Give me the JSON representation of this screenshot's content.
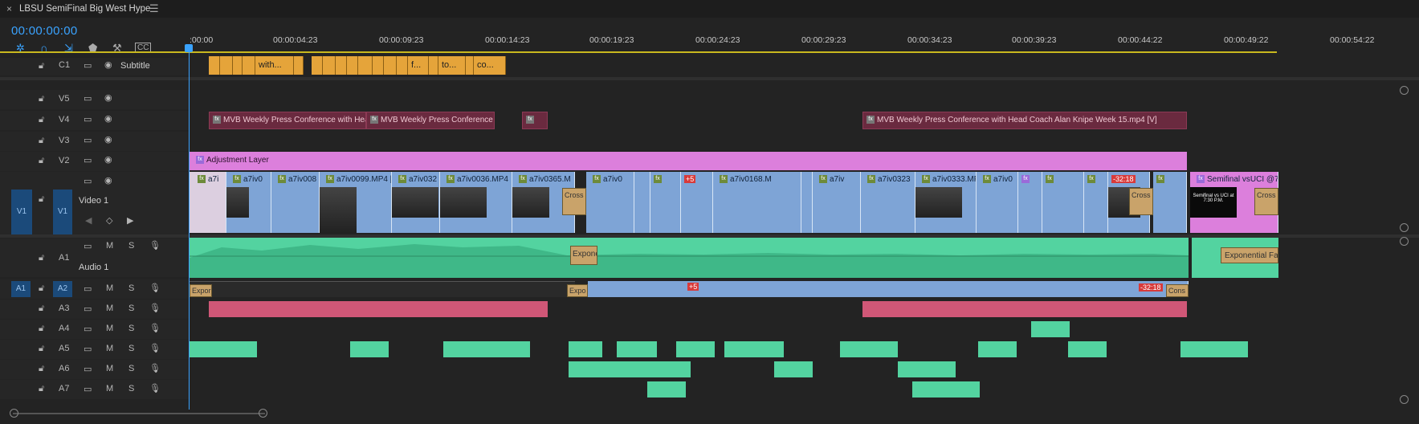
{
  "window": {
    "close_glyph": "×",
    "sequence_name": "LBSU SemiFinal Big West Hype",
    "menu_glyph": "☰"
  },
  "timecode": "00:00:00:00",
  "toolbar": [
    {
      "icon": "snap-icon"
    },
    {
      "icon": "linked-selection-icon"
    },
    {
      "icon": "insert-icon"
    },
    {
      "icon": "marker-icon"
    },
    {
      "icon": "wrench-icon"
    },
    {
      "icon": "captions-icon"
    }
  ],
  "ruler": {
    "labels": [
      ":00:00",
      "00:00:04:23",
      "00:00:09:23",
      "00:00:14:23",
      "00:00:19:23",
      "00:00:24:23",
      "00:00:29:23",
      "00:00:34:23",
      "00:00:39:23",
      "00:00:44:22",
      "00:00:49:22",
      "00:00:54:22"
    ]
  },
  "tracks": {
    "c1": {
      "id": "C1",
      "name": "Subtitle"
    },
    "video": [
      {
        "id": "V5"
      },
      {
        "id": "V4"
      },
      {
        "id": "V3"
      },
      {
        "id": "V2"
      },
      {
        "id": "V1",
        "source": "V1",
        "name": "Video 1"
      }
    ],
    "audio": [
      {
        "id": "A1",
        "name": "Audio 1",
        "m": "M",
        "s": "S"
      },
      {
        "id": "A2",
        "source": "A1",
        "m": "M",
        "s": "S"
      },
      {
        "id": "A3",
        "m": "M",
        "s": "S"
      },
      {
        "id": "A4",
        "m": "M",
        "s": "S"
      },
      {
        "id": "A5",
        "m": "M",
        "s": "S"
      },
      {
        "id": "A6",
        "m": "M",
        "s": "S"
      },
      {
        "id": "A7",
        "m": "M",
        "s": "S"
      }
    ]
  },
  "clips": {
    "subtitles": [
      "with...",
      "f...",
      "to...",
      "co..."
    ],
    "v4": [
      "MVB Weekly Press Conference with Hea",
      "MVB Weekly Press Conference",
      "",
      "MVB Weekly Press Conference with Head Coach Alan Knipe   Week 15.mp4 [V]"
    ],
    "v2": "Adjustment Layer",
    "v1": [
      "a7i",
      "a7iv0",
      "a7iv008",
      "a7iv0099.MP4 [",
      "a7iv032",
      "a7iv0036.MP4",
      "a7iv0365.M",
      "a7iv0",
      "a7iv0168.M",
      "a7iv",
      "a7iv0323",
      "a7iv0333.MP",
      "a7iv0",
      "Semifinal vsUCI @7:"
    ],
    "v1_badges": [
      "+5",
      "-32:18"
    ],
    "v1_transitions": [
      "Cross D",
      "Cross D",
      "Cross D"
    ],
    "semifinal_thumb": "Semifinal vs UCI at 7:30 P.M.",
    "a1_transitions": [
      "Expone",
      "Exponential Fade"
    ],
    "a2_labels": [
      "Expor",
      "Expo",
      "Cons"
    ],
    "a2_badges": [
      "+5",
      "-32:18"
    ],
    "fx_label": "fx"
  },
  "colors": {
    "accent": "#3aa3ff",
    "subtitle": "#e5a43a",
    "graphics": "#6a2a3f",
    "adjustment": "#dc7fdc",
    "video": "#7ea4d6",
    "audio": "#53d3a0",
    "audio_pink": "#d05777"
  }
}
